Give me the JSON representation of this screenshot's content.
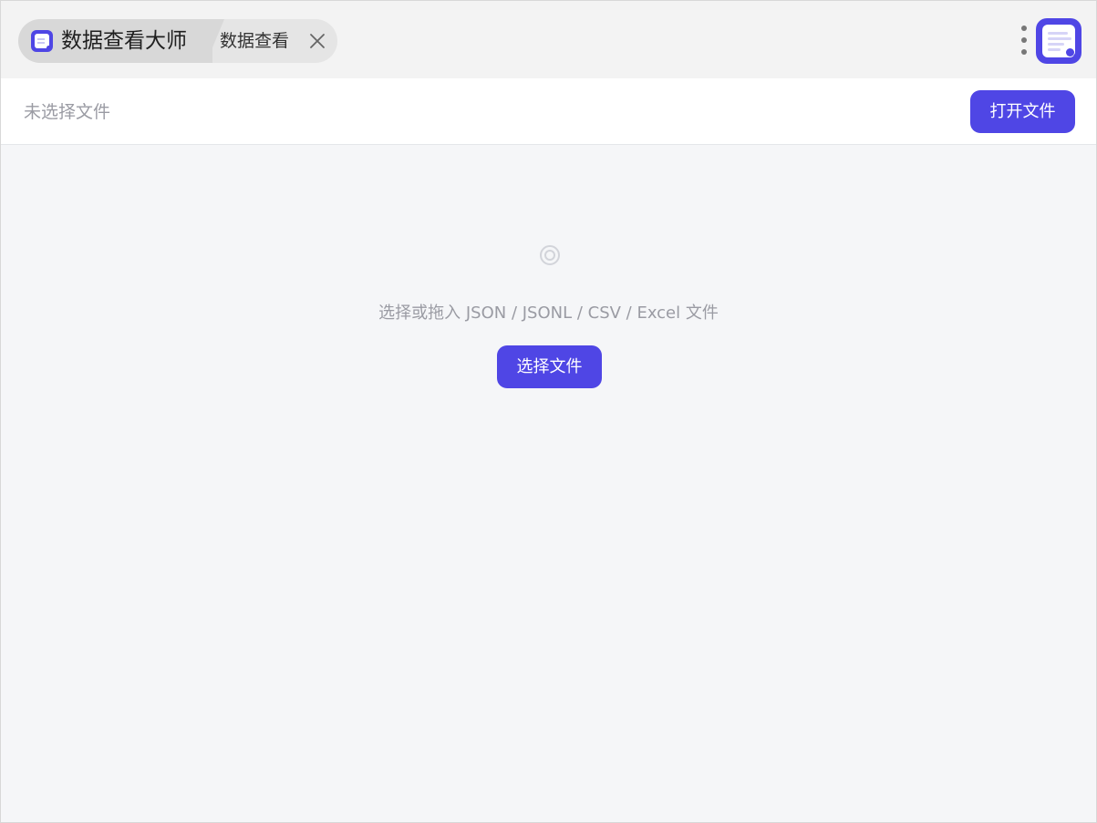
{
  "titlebar": {
    "app_title": "数据查看大师",
    "tab_title": "数据查看",
    "app_icon": "data-viewer-icon",
    "close_icon": "close-icon",
    "menu_icon": "more-vertical-icon"
  },
  "toolbar": {
    "file_status": "未选择文件",
    "open_button_label": "打开文件"
  },
  "empty_state": {
    "icon": "target-icon",
    "message": "选择或拖入 JSON / JSONL / CSV / Excel 文件",
    "choose_button_label": "选择文件"
  },
  "colors": {
    "accent": "#4f46e5",
    "muted_text": "#9a9ba3",
    "background": "#f5f6f8"
  }
}
